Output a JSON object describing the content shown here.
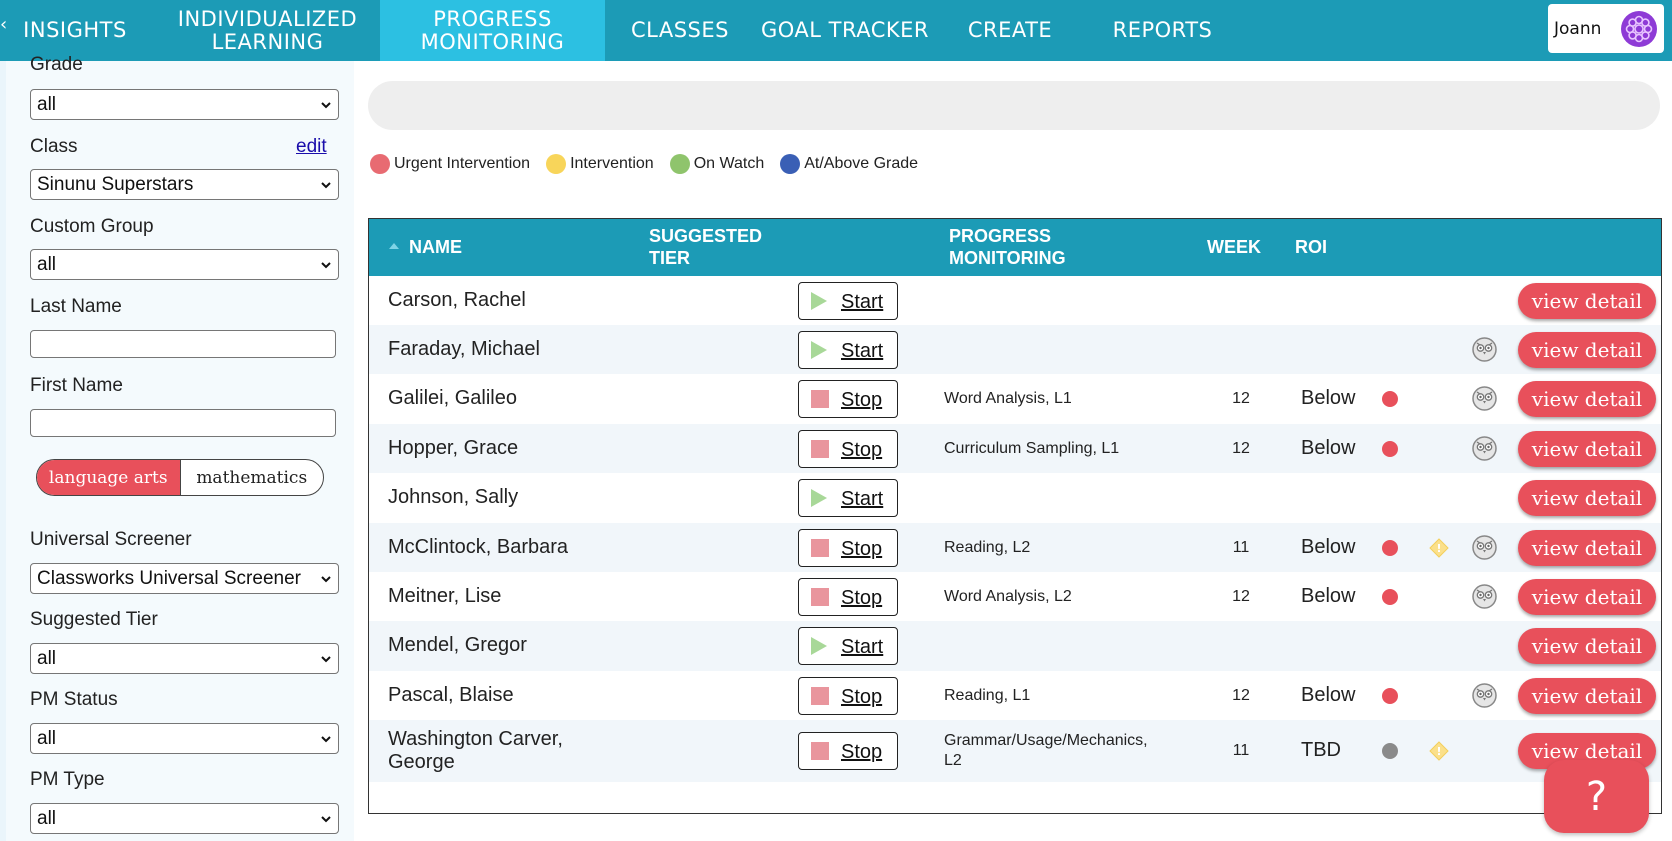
{
  "colors": {
    "nav_bg": "#1c9bb6",
    "nav_active": "#2cc0e2",
    "accent": "#e8505b",
    "urgent": "#e8505b",
    "intervention": "#f8d55a",
    "on_watch": "#8fc46c",
    "at_above": "#3a5fb5",
    "tbd": "#8a8a8a"
  },
  "nav": {
    "items": [
      {
        "label": "INSIGHTS"
      },
      {
        "label": "INDIVIDUALIZED LEARNING"
      },
      {
        "label": "PROGRESS MONITORING",
        "active": true
      },
      {
        "label": "CLASSES"
      },
      {
        "label": "GOAL TRACKER"
      },
      {
        "label": "CREATE"
      },
      {
        "label": "REPORTS"
      }
    ],
    "user_name": "Joann"
  },
  "filters": {
    "grade": {
      "label": "Grade",
      "value": "all"
    },
    "class": {
      "label": "Class",
      "value": "Sinunu Superstars",
      "edit_label": "edit"
    },
    "custom_group": {
      "label": "Custom Group",
      "value": "all"
    },
    "last_name": {
      "label": "Last Name",
      "value": ""
    },
    "first_name": {
      "label": "First Name",
      "value": ""
    },
    "subject_options": [
      "language arts",
      "mathematics"
    ],
    "subject_selected": "language arts",
    "universal_screener": {
      "label": "Universal Screener",
      "value": "Classworks Universal Screener"
    },
    "suggested_tier": {
      "label": "Suggested Tier",
      "value": "all"
    },
    "pm_status": {
      "label": "PM Status",
      "value": "all"
    },
    "pm_type": {
      "label": "PM Type",
      "value": "all"
    }
  },
  "legend": [
    {
      "label": "Urgent Intervention",
      "color": "#e8505b"
    },
    {
      "label": "Intervention",
      "color": "#f8d55a"
    },
    {
      "label": "On Watch",
      "color": "#8fc46c"
    },
    {
      "label": "At/Above Grade",
      "color": "#3a5fb5"
    }
  ],
  "table": {
    "headers": {
      "name": "NAME",
      "tier": "SUGGESTED TIER",
      "pm": "PROGRESS MONITORING",
      "week": "WEEK",
      "roi": "ROI"
    },
    "view_detail_label": "view detail",
    "rows": [
      {
        "name": "Carson, Rachel",
        "action": "Start",
        "pm": "",
        "week": "",
        "roi": "",
        "status": "",
        "warn": false,
        "owl": false
      },
      {
        "name": "Faraday, Michael",
        "action": "Start",
        "pm": "",
        "week": "",
        "roi": "",
        "status": "",
        "warn": false,
        "owl": true
      },
      {
        "name": "Galilei, Galileo",
        "action": "Stop",
        "pm": "Word Analysis, L1",
        "week": "12",
        "roi": "Below",
        "status": "urgent",
        "warn": false,
        "owl": true
      },
      {
        "name": "Hopper, Grace",
        "action": "Stop",
        "pm": "Curriculum Sampling, L1",
        "week": "12",
        "roi": "Below",
        "status": "urgent",
        "warn": false,
        "owl": true
      },
      {
        "name": "Johnson, Sally",
        "action": "Start",
        "pm": "",
        "week": "",
        "roi": "",
        "status": "",
        "warn": false,
        "owl": false
      },
      {
        "name": "McClintock, Barbara",
        "action": "Stop",
        "pm": "Reading, L2",
        "week": "11",
        "roi": "Below",
        "status": "urgent",
        "warn": true,
        "owl": true
      },
      {
        "name": "Meitner, Lise",
        "action": "Stop",
        "pm": "Word Analysis, L2",
        "week": "12",
        "roi": "Below",
        "status": "urgent",
        "warn": false,
        "owl": true
      },
      {
        "name": "Mendel, Gregor",
        "action": "Start",
        "pm": "",
        "week": "",
        "roi": "",
        "status": "",
        "warn": false,
        "owl": false
      },
      {
        "name": "Pascal, Blaise",
        "action": "Stop",
        "pm": "Reading, L1",
        "week": "12",
        "roi": "Below",
        "status": "urgent",
        "warn": false,
        "owl": true
      },
      {
        "name": "Washington Carver, George",
        "action": "Stop",
        "pm": "Grammar/Usage/Mechanics, L2",
        "week": "11",
        "roi": "TBD",
        "status": "tbd",
        "warn": true,
        "owl": false
      }
    ]
  },
  "help": {
    "label": "?"
  }
}
